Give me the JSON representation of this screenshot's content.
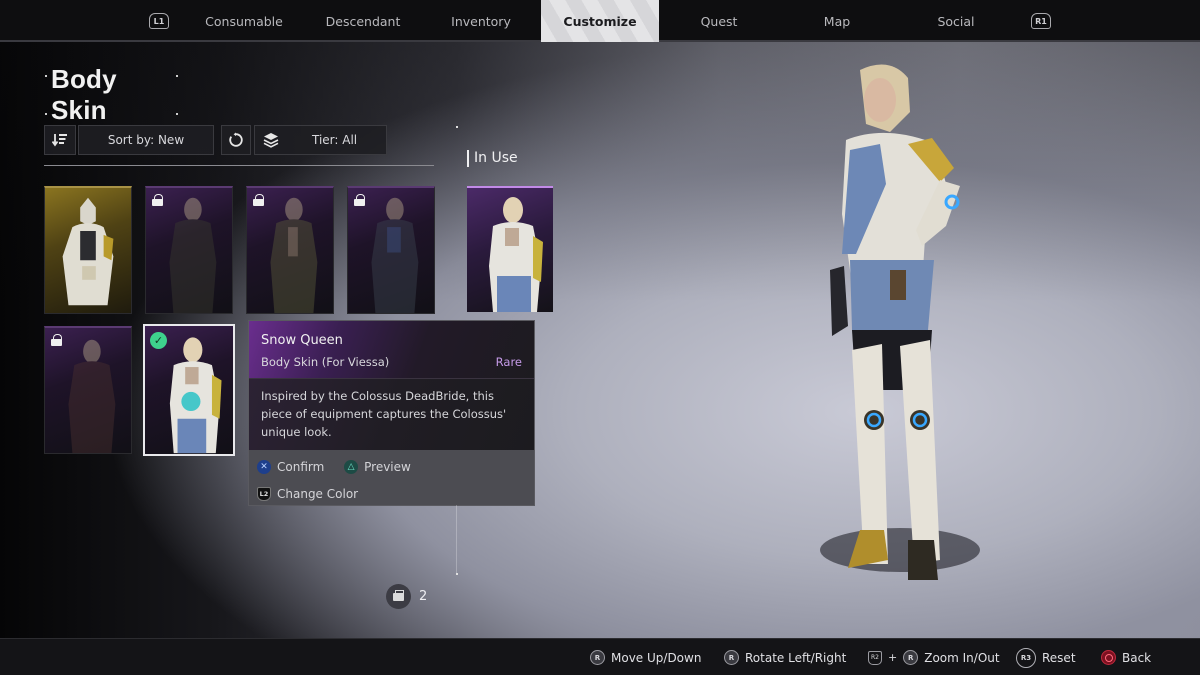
{
  "nav": {
    "left_bumper": "L1",
    "right_bumper": "R1",
    "tabs": [
      {
        "label": "Consumable",
        "active": false
      },
      {
        "label": "Descendant",
        "active": false
      },
      {
        "label": "Inventory",
        "active": false
      },
      {
        "label": "Customize",
        "active": true
      },
      {
        "label": "Quest",
        "active": false
      },
      {
        "label": "Map",
        "active": false
      },
      {
        "label": "Social",
        "active": false
      }
    ]
  },
  "page": {
    "title": "Body Skin",
    "sort_label": "Sort by: New",
    "tier_label": "Tier: All",
    "icons": {
      "sort": "sort-descending-icon",
      "reset": "refresh-icon",
      "tier": "layers-icon"
    }
  },
  "skins": [
    {
      "rarity_color": "#8a7420",
      "locked": false,
      "selected": false,
      "variant": "gold-helmet"
    },
    {
      "rarity_color": "#3b2050",
      "locked": true,
      "selected": false,
      "variant": "dark"
    },
    {
      "rarity_color": "#3b2050",
      "locked": true,
      "selected": false,
      "variant": "olive"
    },
    {
      "rarity_color": "#3b2050",
      "locked": true,
      "selected": false,
      "variant": "blue-dark"
    },
    {
      "rarity_color": "#3b2050",
      "locked": true,
      "selected": false,
      "variant": "red-dark"
    },
    {
      "rarity_color": "#3b2050",
      "locked": false,
      "selected": true,
      "equipped_check": true,
      "variant": "snow-queen"
    }
  ],
  "in_use": {
    "label": "In Use",
    "skin": "Snow Queen"
  },
  "tooltip": {
    "name": "Snow Queen",
    "type": "Body Skin (For Viessa)",
    "rarity": "Rare",
    "rarity_color": "#c59be8",
    "description": "Inspired by the Colossus DeadBride, this piece of equipment captures the Colossus' unique look.",
    "actions": [
      {
        "button": "✕",
        "label": "Confirm"
      },
      {
        "button": "△",
        "label": "Preview"
      },
      {
        "button": "L2",
        "label": "Change Color"
      }
    ]
  },
  "inventory_count": "2",
  "bottom_hints": [
    {
      "button": "R",
      "label": "Move Up/Down"
    },
    {
      "button": "R",
      "label": "Rotate Left/Right"
    },
    {
      "button": "R2 + R",
      "label": "Zoom In/Out"
    },
    {
      "button": "R3",
      "label": "Reset"
    },
    {
      "button": "○",
      "label": "Back"
    }
  ]
}
